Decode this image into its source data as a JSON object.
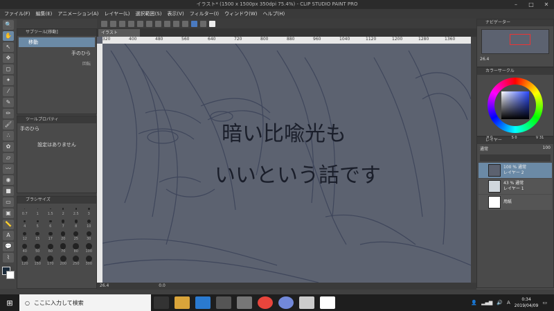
{
  "window": {
    "title": "イラスト* (1500 x 1500px 350dpi 75.4%) - CLIP STUDIO PAINT PRO",
    "min": "–",
    "max": "□",
    "close": "✕"
  },
  "menu": [
    "ファイル(F)",
    "編集(E)",
    "アニメーション(A)",
    "レイヤー(L)",
    "選択範囲(S)",
    "表示(V)",
    "フィルター(I)",
    "ウィンドウ(W)",
    "ヘルプ(H)"
  ],
  "left_panels": {
    "subtool_title": "サブツール[移動]",
    "subtool_item": "移動",
    "subtool_sub": "手のひら",
    "subtool_sub2": "回転",
    "property_title": "ツールプロパティ",
    "property_name": "手のひら",
    "property_empty": "設定はありません",
    "brush_title": "ブラシサイズ",
    "brush_sizes": [
      "0.7",
      "1",
      "1.5",
      "2",
      "2.5",
      "3",
      "4",
      "5",
      "6",
      "7",
      "8",
      "10",
      "12",
      "15",
      "17",
      "20",
      "25",
      "30",
      "40",
      "50",
      "60",
      "70",
      "80",
      "100",
      "120",
      "150",
      "170",
      "200",
      "250",
      "300"
    ]
  },
  "canvas": {
    "tab": "イラスト",
    "ruler_ticks": [
      "320",
      "400",
      "480",
      "560",
      "640",
      "720",
      "800",
      "880",
      "960",
      "1040",
      "1120",
      "1200",
      "1280",
      "1360"
    ],
    "handwriting_line1": "暗い比喩光も",
    "handwriting_line2": "いいという話です",
    "zoom": "26.4",
    "angle": "0.0"
  },
  "right_panels": {
    "navigator_title": "ナビゲーター",
    "nav_zoom": "26.4",
    "color_title": "カラーサークル",
    "color_values": [
      "H 0",
      "S 0",
      "V 31"
    ],
    "layer_title": "レイヤー",
    "blend_mode": "通常",
    "opacity": "100",
    "layers": [
      {
        "name": "レイヤー 2",
        "info": "100 % 通常"
      },
      {
        "name": "レイヤー 1",
        "info": "43 % 通常"
      },
      {
        "name": "用紙",
        "info": ""
      }
    ]
  },
  "taskbar": {
    "search_placeholder": "ここに入力して検索",
    "time": "0:34",
    "date": "2019/04/09",
    "ime": "A"
  },
  "colors": {
    "accent": "#6b8aa6",
    "canvas": "#5c6270",
    "stroke": "#1a1e2a"
  }
}
